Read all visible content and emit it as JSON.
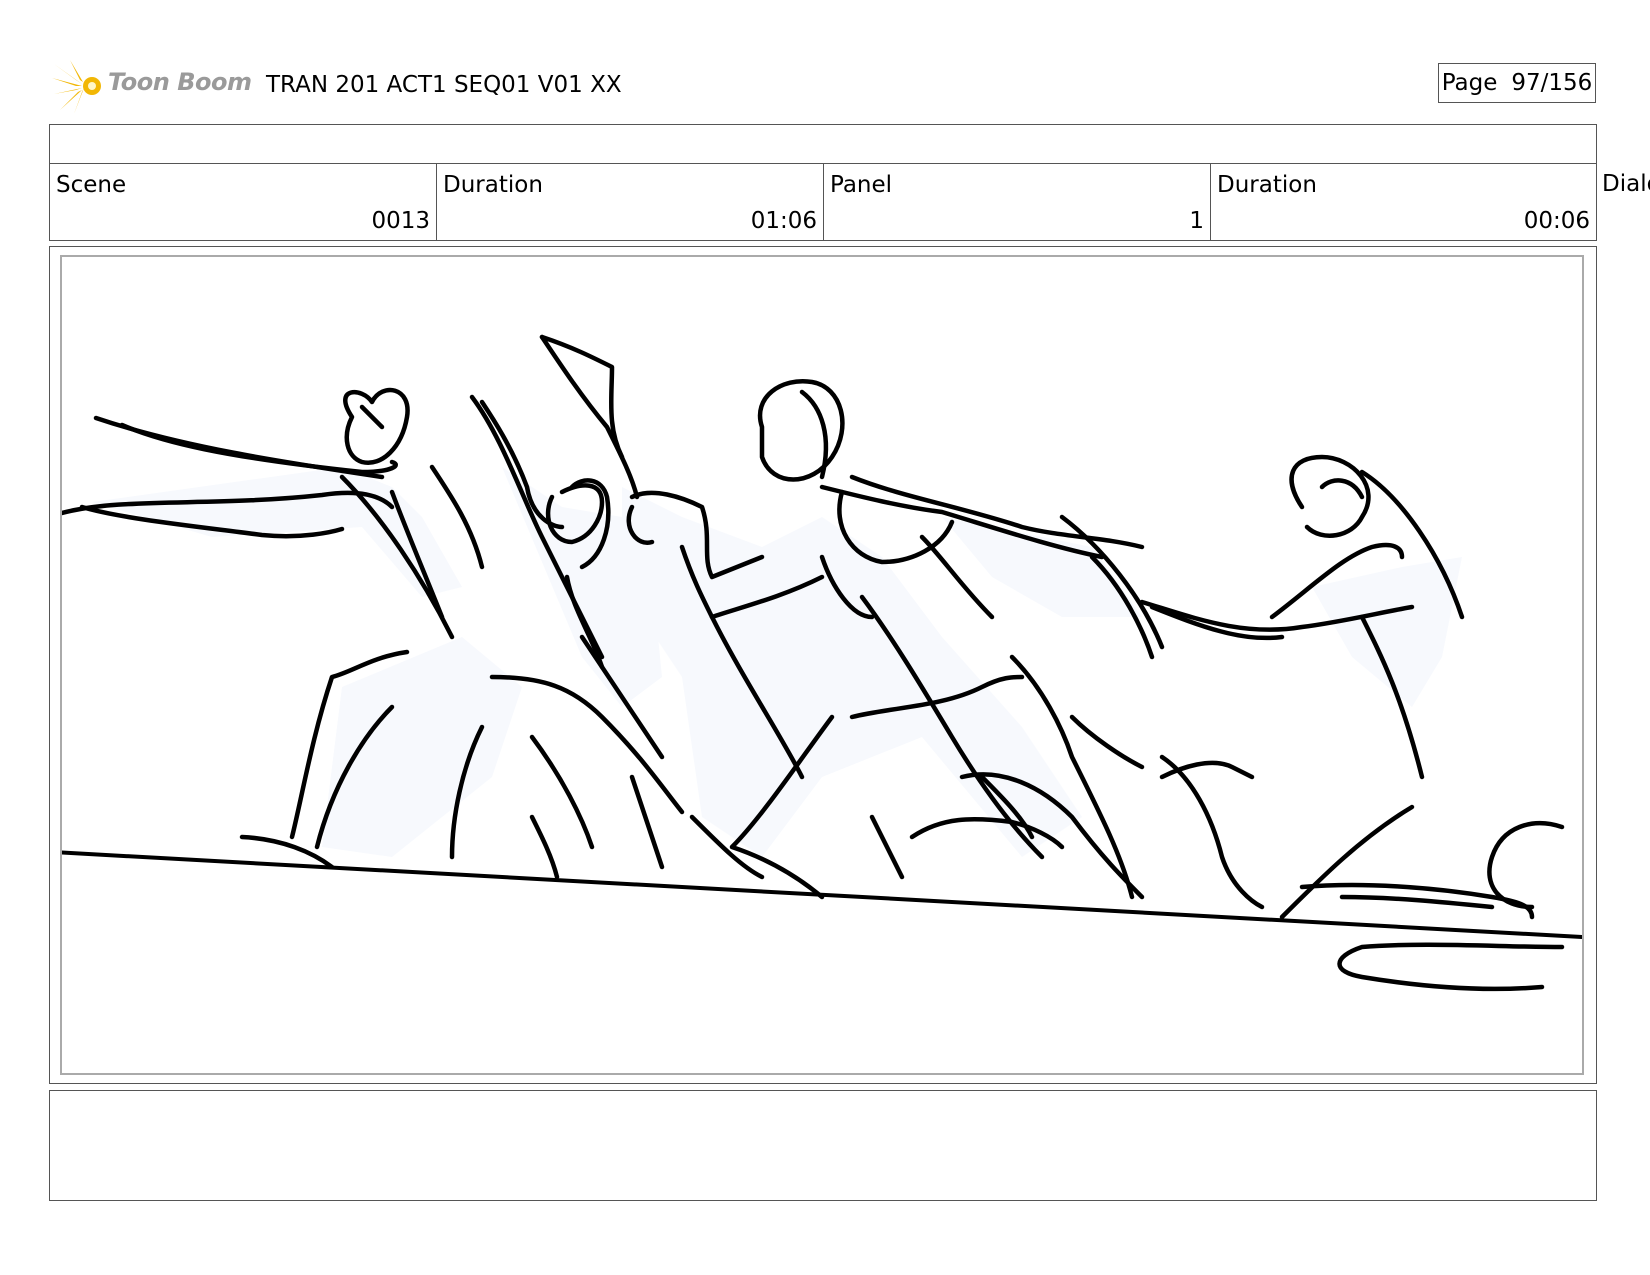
{
  "header": {
    "logo_text": "Toon Boom",
    "doc_title": "TRAN 201 ACT1 SEQ01 V01 XX",
    "page_label": "Page",
    "page_value": "97/156"
  },
  "info": {
    "scene_label": "Scene",
    "scene_value": "0013",
    "duration_label": "Duration",
    "duration_value": "01:06",
    "panel_label": "Panel",
    "panel_value": "1",
    "panel_duration_label": "Duration",
    "panel_duration_value": "00:06",
    "dialog_label": "Dialog"
  },
  "panel": {
    "sketch_fill": "#f7f9fd"
  }
}
